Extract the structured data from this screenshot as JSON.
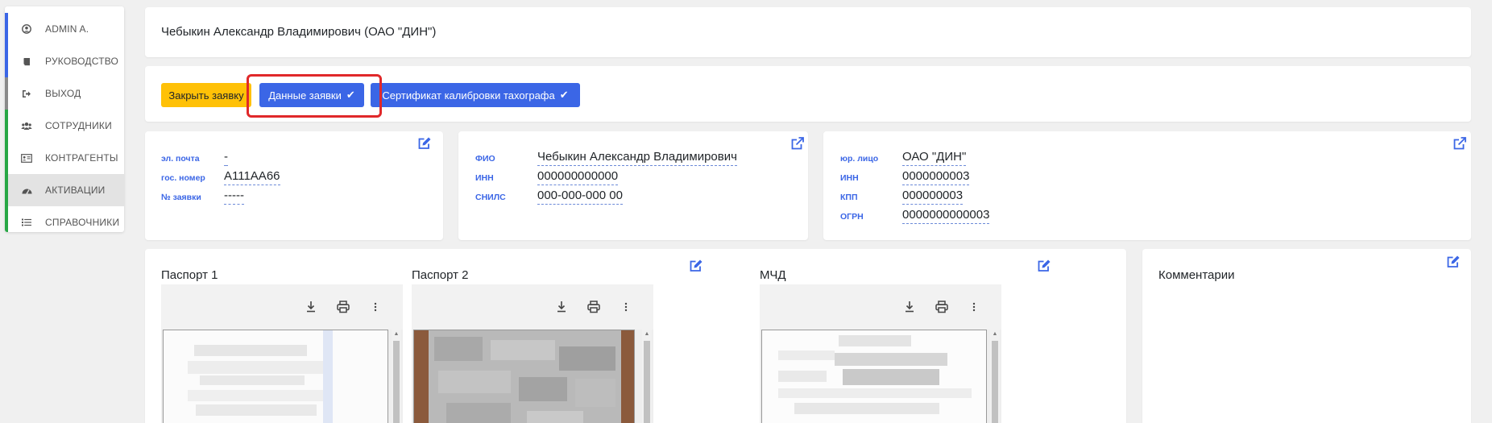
{
  "sidebar": {
    "items": [
      {
        "label": "ADMIN A.",
        "icon": "user-circle-icon",
        "stripe": "#3b66e6"
      },
      {
        "label": "РУКОВОДСТВО",
        "icon": "book-icon",
        "stripe": "#3b66e6"
      },
      {
        "label": "ВЫХОД",
        "icon": "sign-out-icon",
        "stripe": "#8a8a8a"
      },
      {
        "label": "СОТРУДНИКИ",
        "icon": "users-icon",
        "stripe": "#28a745"
      },
      {
        "label": "КОНТРАГЕНТЫ",
        "icon": "id-card-icon",
        "stripe": "#28a745"
      },
      {
        "label": "АКТИВАЦИИ",
        "icon": "dashboard-icon",
        "stripe": "#28a745",
        "active": true
      },
      {
        "label": "СПРАВОЧНИКИ",
        "icon": "list-icon",
        "stripe": "#28a745"
      }
    ]
  },
  "header": {
    "title": "Чебыкин Александр Владимирович (ОАО \"ДИН\")"
  },
  "actions": {
    "close_label": "Закрыть заявку",
    "data_label": "Данные заявки",
    "certificate_label": "Сертификат калибровки тахографа",
    "colors": {
      "yellow": "#ffc107",
      "blue": "#3b66e6",
      "highlight": "#e0282a"
    }
  },
  "request_card": {
    "fields": [
      {
        "label": "эл. почта",
        "value": "-"
      },
      {
        "label": "гос. номер",
        "value": "А111АА66"
      },
      {
        "label": "№ заявки",
        "value": "-----"
      }
    ]
  },
  "person_card": {
    "fields": [
      {
        "label": "ФИО",
        "value": "Чебыкин Александр Владимирович"
      },
      {
        "label": "ИНН",
        "value": "000000000000"
      },
      {
        "label": "СНИЛС",
        "value": "000-000-000 00"
      }
    ]
  },
  "company_card": {
    "fields": [
      {
        "label": "юр. лицо",
        "value": "ОАО \"ДИН\""
      },
      {
        "label": "ИНН",
        "value": "0000000003"
      },
      {
        "label": "КПП",
        "value": "000000003"
      },
      {
        "label": "ОГРН",
        "value": "0000000000003"
      }
    ]
  },
  "documents": {
    "passport1_title": "Паспорт 1",
    "passport2_title": "Паспорт 2",
    "mchd_title": "МЧД"
  },
  "comments": {
    "title": "Комментарии"
  }
}
